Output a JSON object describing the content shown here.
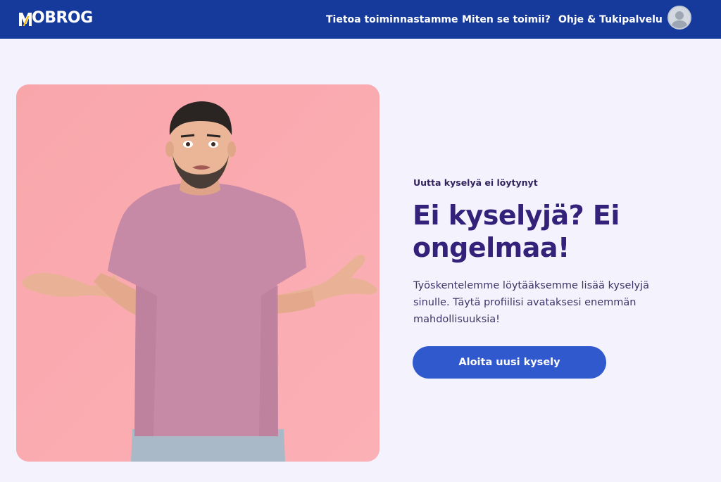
{
  "header": {
    "logo_text": "OBROG",
    "logo_letter": "M",
    "nav": [
      {
        "label": "Tietoa toiminnastamme"
      },
      {
        "label": "Miten se toimii?"
      },
      {
        "label": "Ohje & Tukipalvelu"
      }
    ],
    "avatar_icon": "user-avatar-icon"
  },
  "main": {
    "eyebrow": "Uutta kyselyä ei löytynyt",
    "headline_line1": "Ei kyselyjä? Ei",
    "headline_line2": "ongelmaa!",
    "body_line1": "Työskentelemme löytääksemme lisää kyselyjä",
    "body_line2": "sinulle. Täytä profiilisi avataksesi enemmän",
    "body_line3": "mahdollisuuksia!",
    "cta_label": "Aloita uusi kysely"
  },
  "colors": {
    "header_bg": "#153a9b",
    "page_bg": "#f4f3fd",
    "headline": "#33217a",
    "cta_bg": "#2f59cc",
    "photo_bg": "#f9a7ad"
  }
}
